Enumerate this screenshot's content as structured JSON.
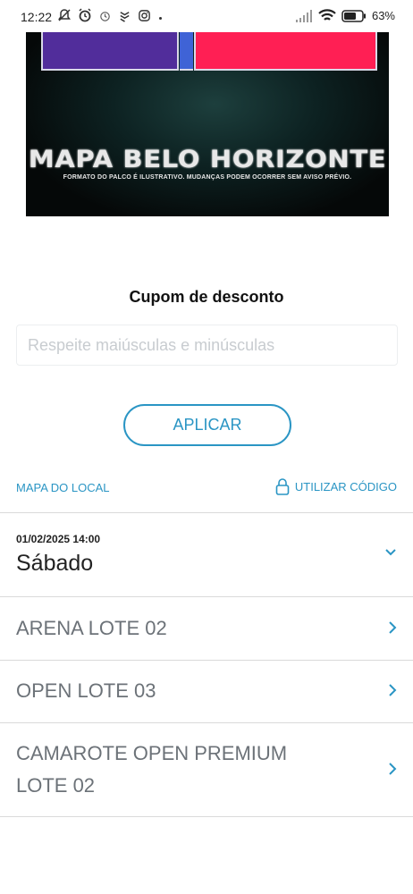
{
  "status_bar": {
    "time": "12:22",
    "battery": "63%"
  },
  "banner": {
    "title": "MAPA BELO HORIZONTE",
    "disclaimer": "FORMATO DO PALCO É ILUSTRATIVO. MUDANÇAS PODEM OCORRER SEM AVISO PRÉVIO."
  },
  "coupon": {
    "title": "Cupom de desconto",
    "placeholder": "Respeite maiúsculas e minúsculas",
    "value": "",
    "apply_label": "APLICAR"
  },
  "links": {
    "map": "MAPA DO LOCAL",
    "use_code": "UTILIZAR CÓDIGO"
  },
  "event": {
    "datetime": "01/02/2025 14:00",
    "day": "Sábado"
  },
  "tickets": [
    {
      "label": "ARENA LOTE 02"
    },
    {
      "label": "OPEN LOTE 03"
    },
    {
      "label_line1": "CAMAROTE OPEN PREMIUM",
      "label_line2": "LOTE 02"
    }
  ],
  "colors": {
    "accent": "#2a95c4",
    "stage_purple": "#512d9b",
    "stage_blue": "#3f63d6",
    "stage_pink": "#ff1f54"
  }
}
